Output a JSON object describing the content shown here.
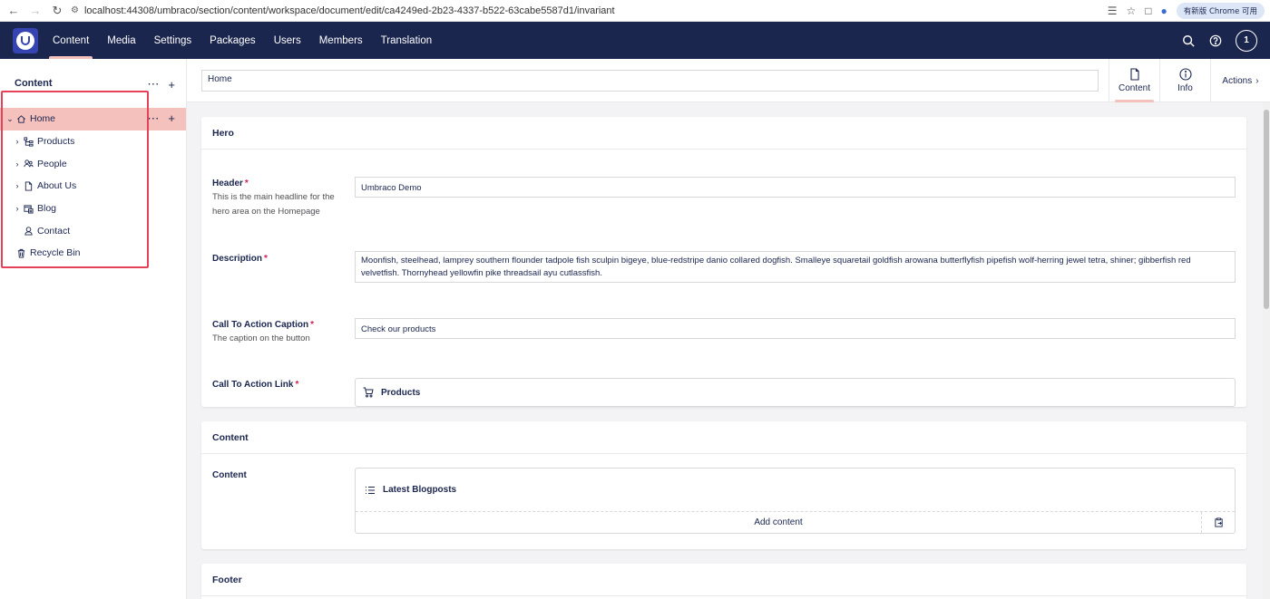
{
  "browser": {
    "url": "localhost:44308/umbraco/section/content/workspace/document/edit/ca4249ed-2b23-4337-b522-63cabe5587d1/invariant",
    "update_label": "有新版 Chrome 可用"
  },
  "topnav": {
    "tabs": [
      "Content",
      "Media",
      "Settings",
      "Packages",
      "Users",
      "Members",
      "Translation"
    ],
    "active_tab": "Content",
    "avatar_initial": "1"
  },
  "sidebar": {
    "title": "Content",
    "tree": [
      {
        "label": "Home",
        "icon": "home-icon",
        "expanded": true,
        "selected": true
      },
      {
        "label": "Products",
        "icon": "sitemap-icon",
        "has_children": true
      },
      {
        "label": "People",
        "icon": "people-icon",
        "has_children": true
      },
      {
        "label": "About Us",
        "icon": "document-icon",
        "has_children": true
      },
      {
        "label": "Blog",
        "icon": "calendar-list-icon",
        "has_children": true
      },
      {
        "label": "Contact",
        "icon": "contact-icon",
        "has_children": false
      },
      {
        "label": "Recycle Bin",
        "icon": "trash-icon",
        "has_children": false
      }
    ]
  },
  "header": {
    "name_value": "Home",
    "tabs": [
      "Content",
      "Info"
    ],
    "actions_label": "Actions"
  },
  "hero": {
    "title": "Hero",
    "header_label": "Header",
    "header_desc": "This is the main headline for the hero area on the Homepage",
    "header_value": "Umbraco Demo",
    "description_label": "Description",
    "description_value": "Moonfish, steelhead, lamprey southern flounder tadpole fish sculpin bigeye, blue-redstripe danio collared dogfish. Smalleye squaretail goldfish arowana butterflyfish pipefish wolf-herring jewel tetra, shiner; gibberfish red velvetfish. Thornyhead yellowfin pike threadsail ayu cutlassfish.",
    "cta_caption_label": "Call To Action Caption",
    "cta_caption_desc": "The caption on the button",
    "cta_caption_value": "Check our products",
    "cta_link_label": "Call To Action Link",
    "cta_link_value": "Products"
  },
  "content": {
    "title": "Content",
    "content_label": "Content",
    "block_label": "Latest Blogposts",
    "add_label": "Add content"
  },
  "footer": {
    "title": "Footer"
  },
  "colors": {
    "nav_bg": "#1b264f",
    "accent": "#f5c1bc",
    "highlight": "#e5425a",
    "required": "#d42054"
  }
}
